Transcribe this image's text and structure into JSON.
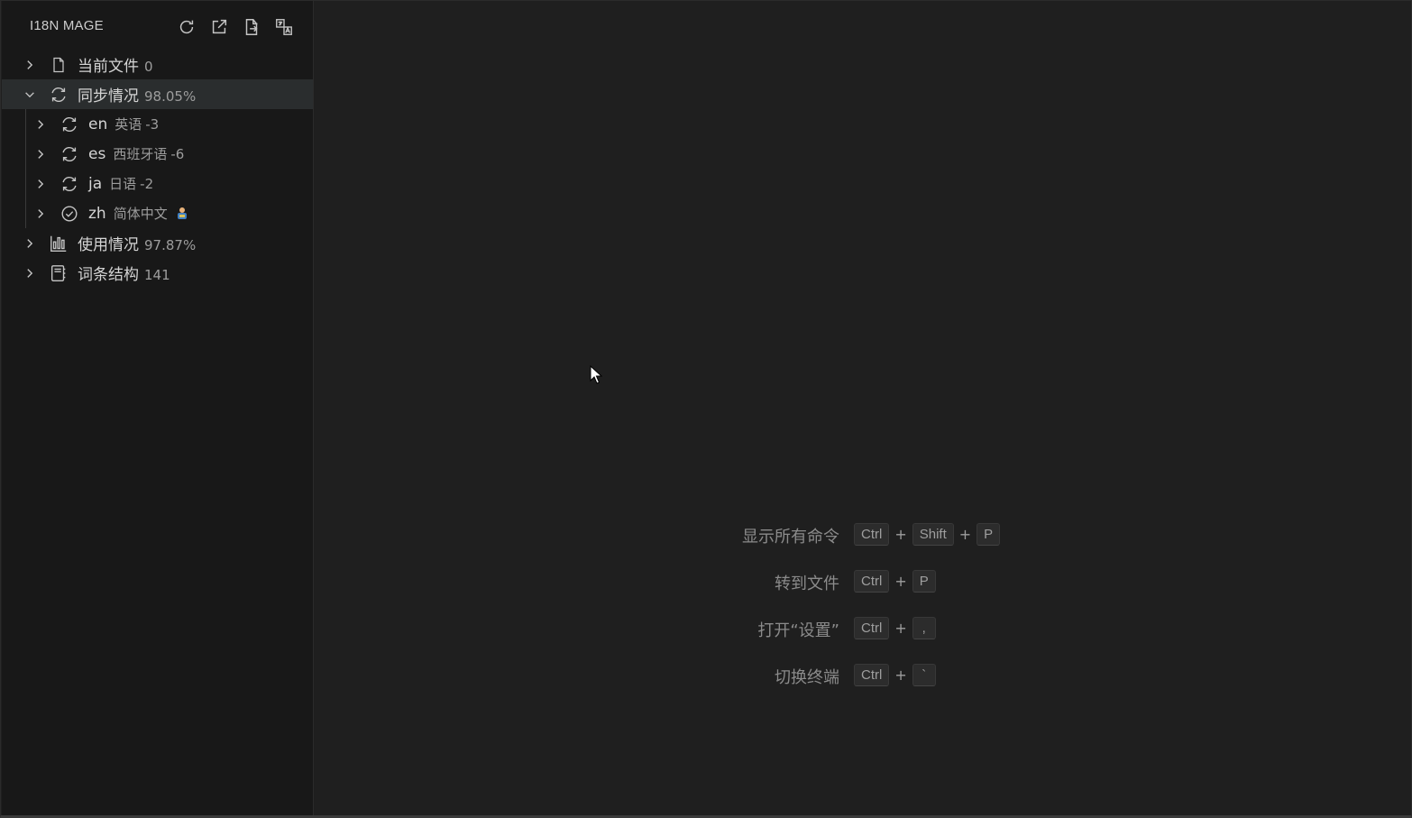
{
  "sidebar": {
    "title": "I18N MAGE",
    "actions": [
      {
        "icon": "refresh-icon"
      },
      {
        "icon": "open-external-icon"
      },
      {
        "icon": "export-file-icon"
      },
      {
        "icon": "translate-icon"
      }
    ],
    "tree": {
      "current_file": {
        "label": "当前文件",
        "desc": "0",
        "expanded": false
      },
      "sync": {
        "label": "同步情况",
        "desc": "98.05%",
        "expanded": true,
        "children": [
          {
            "code": "en",
            "name": "英语",
            "desc": "-3",
            "icon": "sync-icon"
          },
          {
            "code": "es",
            "name": "西班牙语",
            "desc": "-6",
            "icon": "sync-icon"
          },
          {
            "code": "ja",
            "name": "日语",
            "desc": "-2",
            "icon": "sync-icon"
          },
          {
            "code": "zh",
            "name": "简体中文",
            "desc": "",
            "icon": "check-circle-icon"
          }
        ]
      },
      "usage": {
        "label": "使用情况",
        "desc": "97.87%",
        "expanded": false
      },
      "structure": {
        "label": "词条结构",
        "desc": "141",
        "expanded": false
      }
    }
  },
  "editor": {
    "shortcuts": [
      {
        "label": "显示所有命令",
        "keys": [
          "Ctrl",
          "Shift",
          "P"
        ]
      },
      {
        "label": "转到文件",
        "keys": [
          "Ctrl",
          "P"
        ]
      },
      {
        "label": "打开“设置”",
        "keys": [
          "Ctrl",
          ","
        ]
      },
      {
        "label": "切换终端",
        "keys": [
          "Ctrl",
          "`"
        ]
      }
    ],
    "key_separator": "+"
  },
  "colors": {
    "background": "#1f1f1f",
    "sidebar": "#181818",
    "selected_row": "#2a2d2e",
    "text": "#cccccc",
    "muted": "#9d9d9d"
  }
}
